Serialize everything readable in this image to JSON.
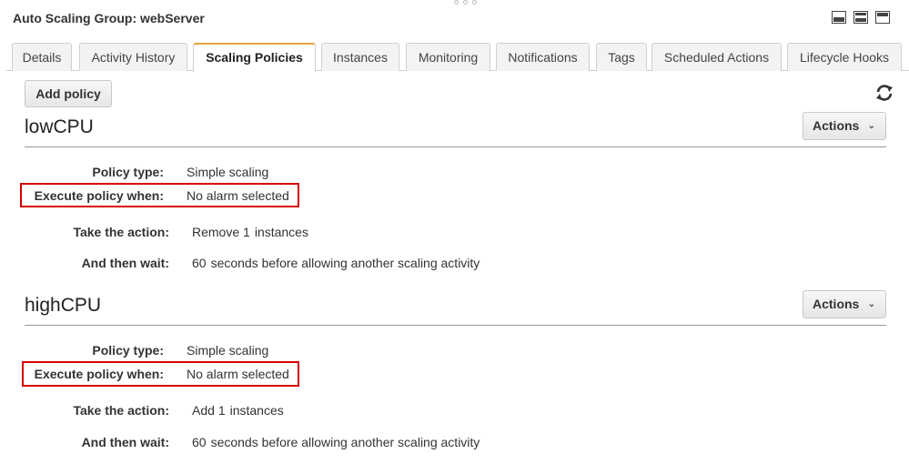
{
  "header": {
    "title": "Auto Scaling Group: webServer"
  },
  "tabs": [
    {
      "label": "Details"
    },
    {
      "label": "Activity History"
    },
    {
      "label": "Scaling Policies"
    },
    {
      "label": "Instances"
    },
    {
      "label": "Monitoring"
    },
    {
      "label": "Notifications"
    },
    {
      "label": "Tags"
    },
    {
      "label": "Scheduled Actions"
    },
    {
      "label": "Lifecycle Hooks"
    }
  ],
  "toolbar": {
    "add_policy_label": "Add policy"
  },
  "labels": {
    "policy_type": "Policy type:",
    "execute_when": "Execute policy when:",
    "take_action": "Take the action:",
    "then_wait": "And then wait:",
    "actions": "Actions"
  },
  "policies": [
    {
      "name": "lowCPU",
      "policy_type": "Simple scaling",
      "execute_when": "No alarm selected",
      "action_verb": "Remove",
      "action_count": "1",
      "action_unit": "instances",
      "wait_seconds": "60",
      "wait_text": "seconds before allowing another scaling activity"
    },
    {
      "name": "highCPU",
      "policy_type": "Simple scaling",
      "execute_when": "No alarm selected",
      "action_verb": "Add",
      "action_count": "1",
      "action_unit": "instances",
      "wait_seconds": "60",
      "wait_text": "seconds before allowing another scaling activity"
    }
  ],
  "colors": {
    "active_tab_accent": "#e7a33a",
    "highlight_border": "#d90000"
  },
  "icons": {
    "refresh": "refresh-icon",
    "chevron": "chevron-down-icon"
  }
}
